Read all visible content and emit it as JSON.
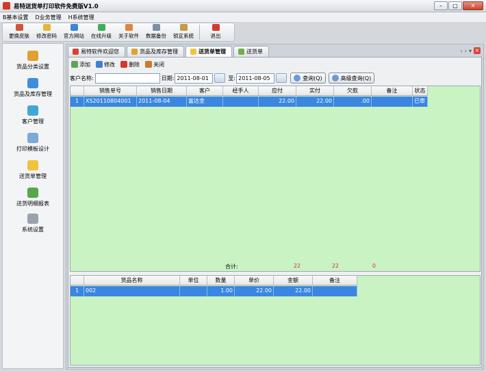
{
  "window": {
    "title": "易特送货单打印软件免费版V1.0"
  },
  "menu": [
    "B基本设置",
    "D业务管理",
    "H系统管理"
  ],
  "toolbar": [
    {
      "label": "更换皮肤",
      "color": "#d0563b"
    },
    {
      "label": "修改密码",
      "color": "#e7b43a"
    },
    {
      "label": "官方网站",
      "color": "#3d86d6"
    },
    {
      "label": "在线升级",
      "color": "#3fae5c"
    },
    {
      "label": "关于软件",
      "color": "#e2843a"
    },
    {
      "label": "数据备份",
      "color": "#7c8fa7"
    },
    {
      "label": "锁定系统",
      "color": "#c79a46"
    },
    {
      "label": "退出",
      "color": "#d33a2f"
    }
  ],
  "sidebar": [
    {
      "label": "货品分类设置",
      "color": "#e0a12f"
    },
    {
      "label": "货品及库存管理",
      "color": "#3f8fd8"
    },
    {
      "label": "客户管理",
      "color": "#46a5d8"
    },
    {
      "label": "打印模板设计",
      "color": "#7da9d6"
    },
    {
      "label": "送货单管理",
      "color": "#f0c43a"
    },
    {
      "label": "送货明细报表",
      "color": "#56a84a"
    },
    {
      "label": "系统设置",
      "color": "#9aa3ad"
    }
  ],
  "tabs": [
    {
      "label": "易特软件欢迎您",
      "color": "#d4452f"
    },
    {
      "label": "货品及库存管理",
      "color": "#e0a12f"
    },
    {
      "label": "送货单管理",
      "color": "#f0c43a"
    },
    {
      "label": "送货单",
      "color": "#6fb04a"
    }
  ],
  "actions": [
    {
      "label": "添加",
      "color": "#5aa55a"
    },
    {
      "label": "修改",
      "color": "#3f7fd3"
    },
    {
      "label": "删除",
      "color": "#d33a2f"
    },
    {
      "label": "关闭",
      "color": "#cc7a2e"
    }
  ],
  "filter": {
    "customer_label": "客户名称:",
    "customer_value": "",
    "date_label": "日期:",
    "date_from": "2011-08-01",
    "to_label": "至:",
    "date_to": "2011-08-05",
    "query_label": "查询(Q)",
    "advanced_label": "高级查询(Q)"
  },
  "orders": {
    "columns": [
      "",
      "销售单号",
      "销售日期",
      "客户",
      "经手人",
      "应付",
      "实付",
      "欠款",
      "备注",
      "状态"
    ],
    "rows": [
      [
        "1",
        "XS20110804001",
        "2011-08-04",
        "富达金",
        "",
        "22.00",
        "22.00",
        ".00",
        "",
        "已审"
      ]
    ],
    "totals_label": "合计:",
    "totals": [
      "22",
      "22",
      "0"
    ]
  },
  "details": {
    "columns": [
      "",
      "货品名称",
      "单位",
      "数量",
      "单价",
      "金额",
      "备注"
    ],
    "rows": [
      [
        "1",
        "002",
        "",
        "1.00",
        "22.00",
        "22.00",
        ""
      ]
    ]
  },
  "colors": {
    "grid_bg": "#c9f3c3",
    "selected_row": "#3a86e0",
    "totals_red": "#d8312a"
  }
}
